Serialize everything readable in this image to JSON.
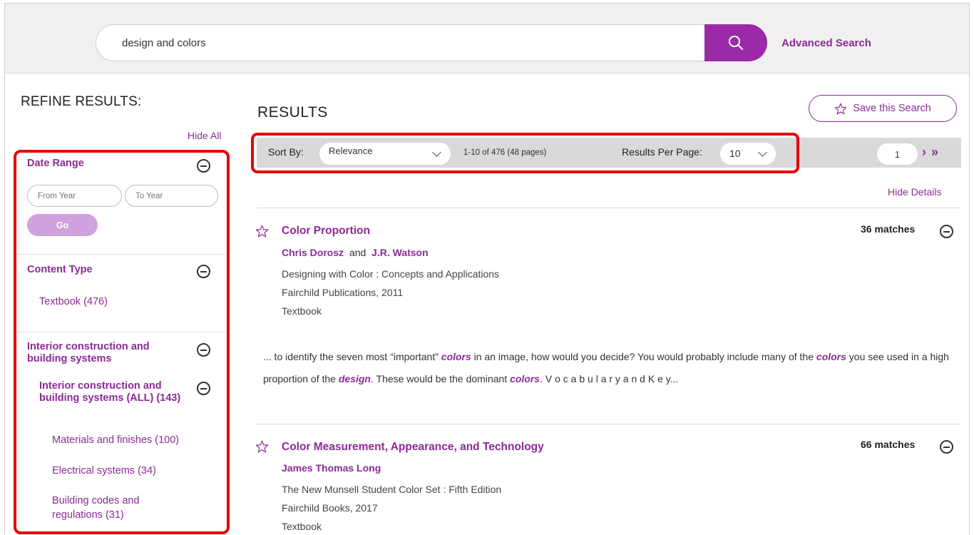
{
  "search": {
    "query": "design and colors",
    "advanced_label": "Advanced Search"
  },
  "sidebar": {
    "title": "REFINE RESULTS:",
    "hide_all": "Hide All",
    "date_range": {
      "heading": "Date Range",
      "from_placeholder": "From Year",
      "to_placeholder": "To Year",
      "go_label": "Go"
    },
    "content_type": {
      "heading": "Content Type",
      "items": [
        "Textbook (476)"
      ]
    },
    "subject": {
      "heading": "Interior construction and building systems",
      "sub_heading": "Interior construction and building systems (ALL) (143)",
      "items": [
        "Materials and finishes (100)",
        "Electrical systems (34)",
        "Building codes and regulations (31)"
      ]
    }
  },
  "results": {
    "title": "RESULTS",
    "save_search": "Save this Search",
    "sort_label": "Sort By:",
    "sort_value": "Relevance",
    "count": "1-10 of 476 (48 pages)",
    "per_page_label": "Results Per Page:",
    "per_page_value": "10",
    "page_value": "1",
    "hide_details": "Hide Details",
    "items": [
      {
        "title": "Color Proportion",
        "author1": "Chris Dorosz",
        "and": "and",
        "author2": "J.R. Watson",
        "book": "Designing with Color : Concepts and Applications",
        "publisher": "Fairchild Publications, 2011",
        "type": "Textbook",
        "matches": "36 matches",
        "snippet": [
          "... to identify the seven most “important” ",
          "colors",
          " in an image, how would you decide? You would probably include many of the ",
          "colors",
          " you see used in a high proportion of the ",
          "design",
          ". These would be the dominant ",
          "colors",
          ". V o c a b u l a r y a n d K e y..."
        ]
      },
      {
        "title": "Color Measurement, Appearance, and Technology",
        "author1": "James Thomas Long",
        "book": "The New Munsell Student Color Set : Fifth Edition",
        "publisher": "Fairchild Books, 2017",
        "type": "Textbook",
        "matches": "66 matches"
      }
    ]
  },
  "colors": {
    "accent": "#8a2b96",
    "search_button": "#9b2aa8",
    "highlight_border": "#e60000"
  }
}
